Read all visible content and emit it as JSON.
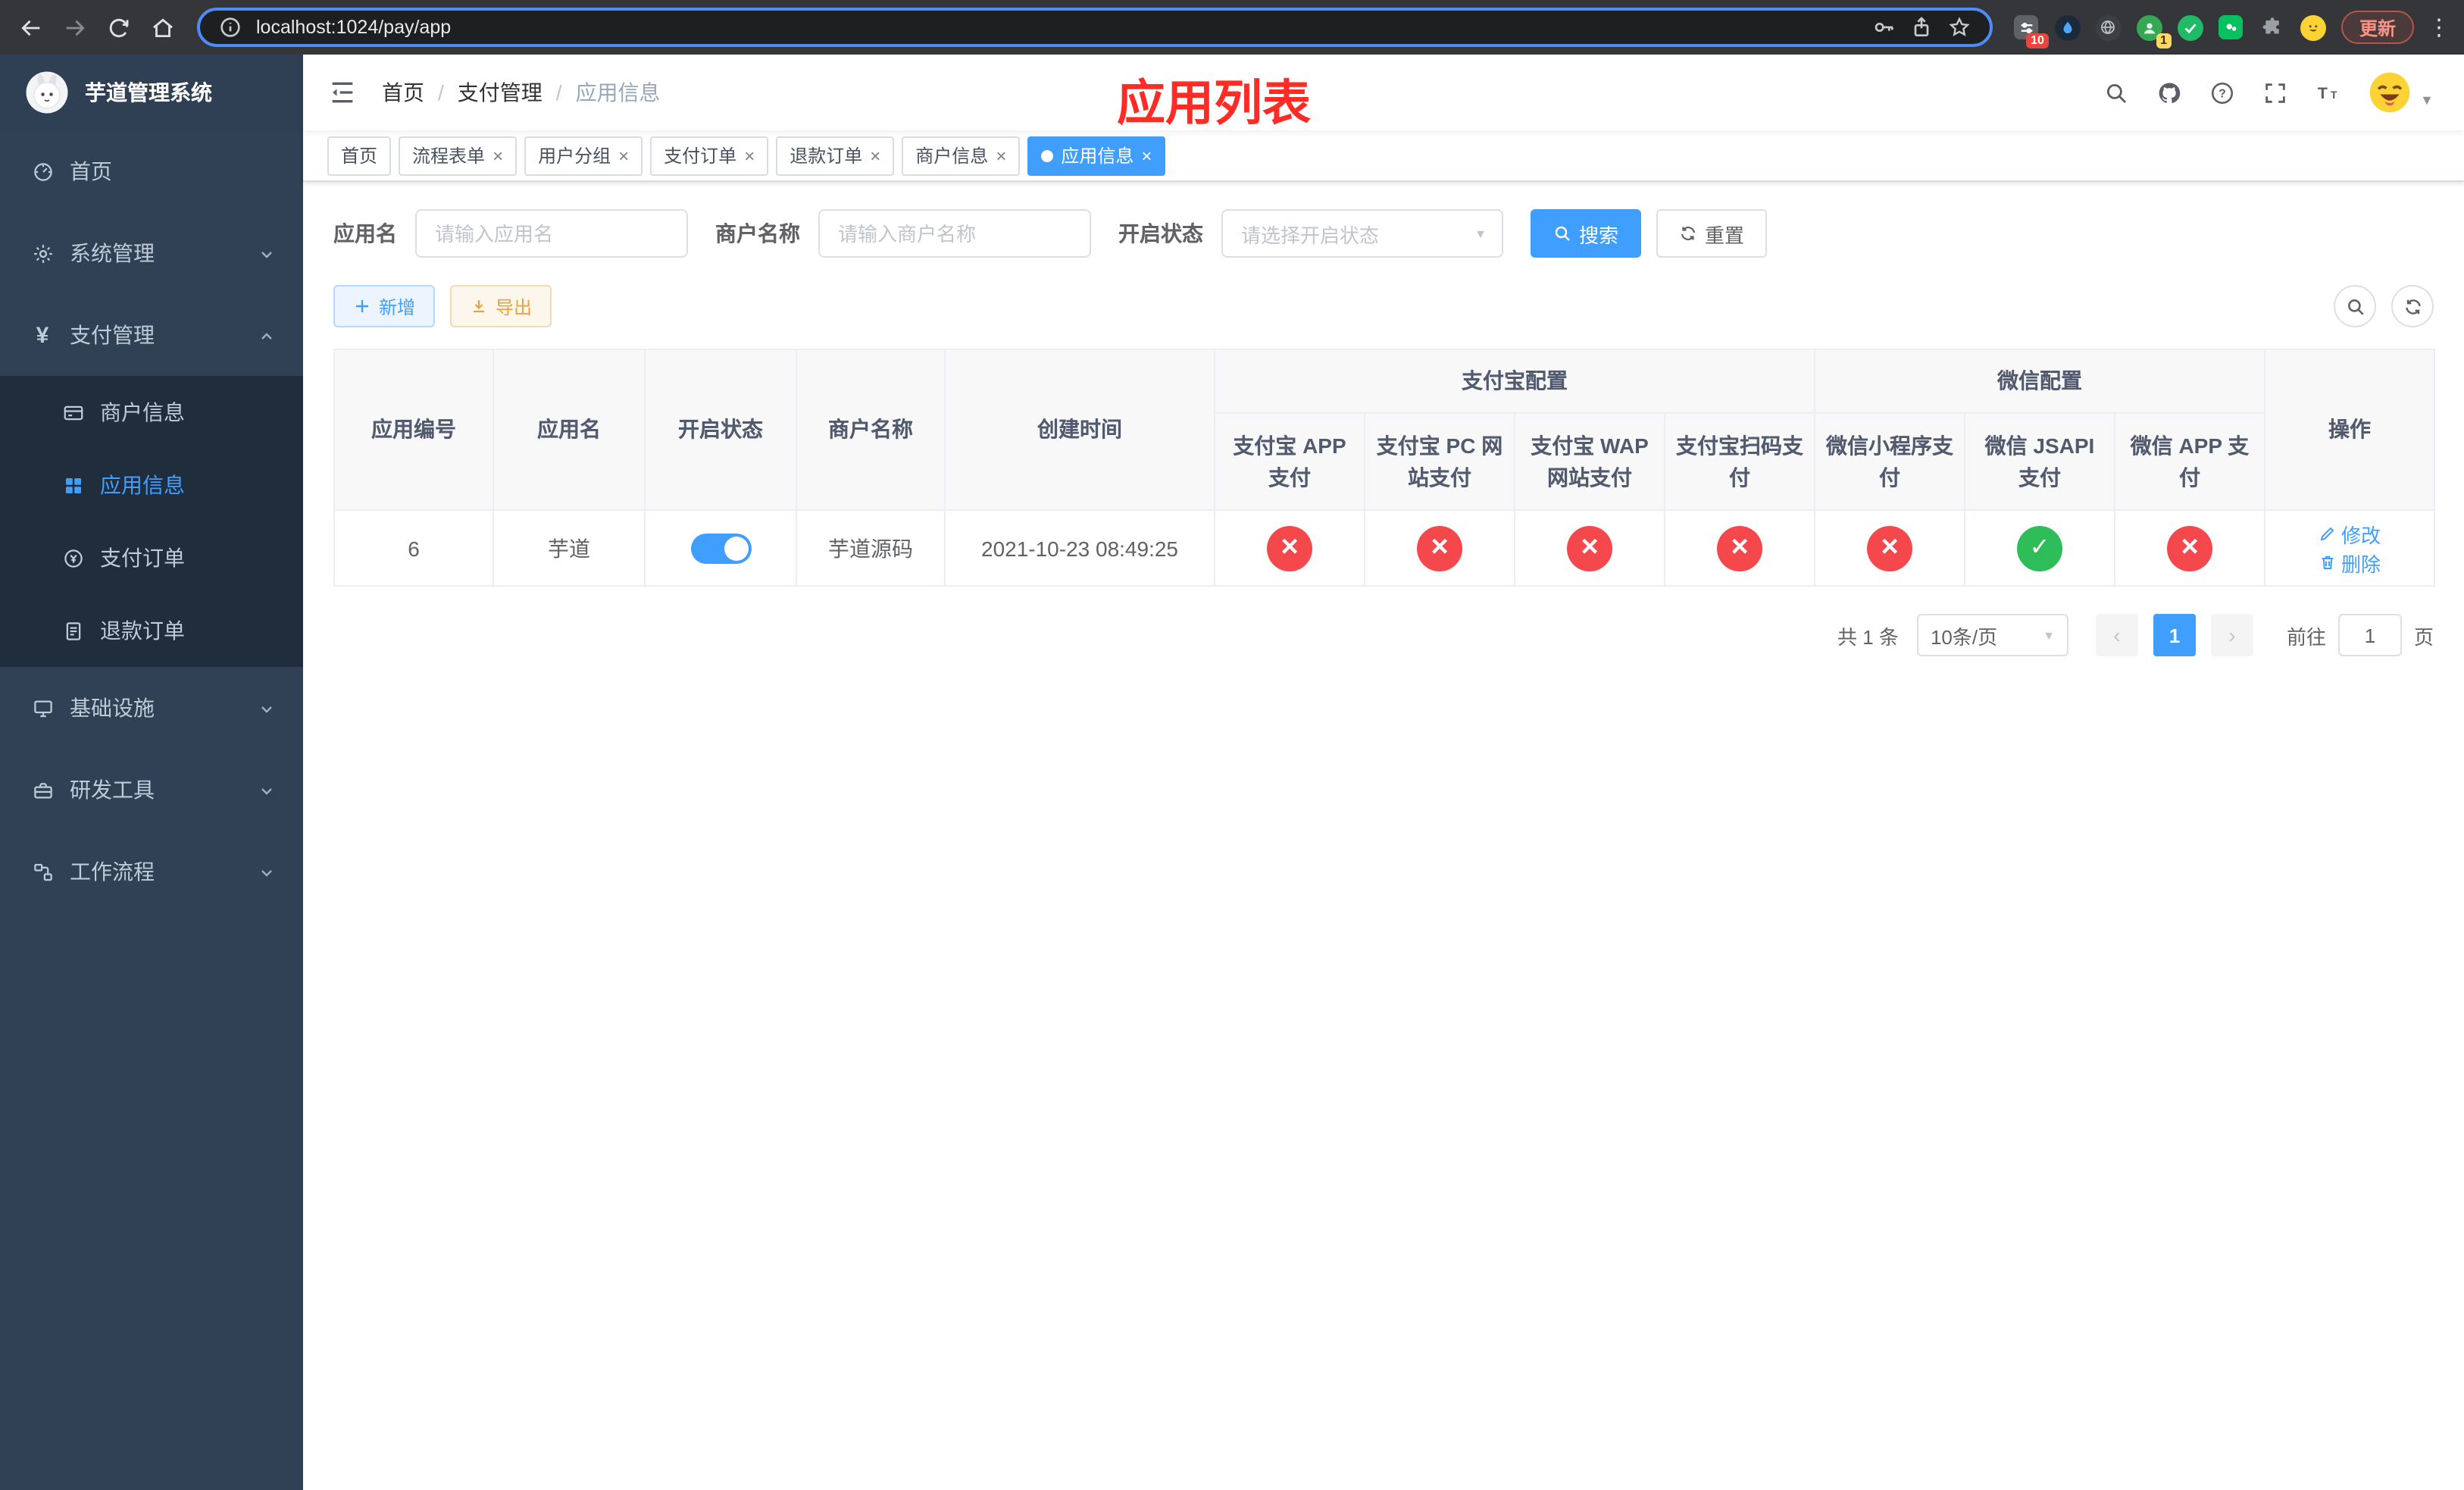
{
  "colors": {
    "accent": "#409EFF",
    "success": "#2ebd59",
    "danger": "#f5484d",
    "warning": "#e6a23c",
    "sidebar_bg": "#304156",
    "submenu_bg": "#1f2d3d",
    "overlay_title_red": "#fe2c24",
    "omnibox_focus_ring": "#4d8cf5",
    "browser_toolbar_bg": "#35363a"
  },
  "icons": {
    "close": "×",
    "check": "✓",
    "cross": "×",
    "caret_down": "▼",
    "more_vertical": "⋮",
    "prev": "‹",
    "next": "›",
    "yen": "¥"
  },
  "browser": {
    "url": "localhost:1024/pay/app",
    "update_button": "更新",
    "extensions": [
      {
        "name": "sliders-extension",
        "badge": "10"
      },
      {
        "name": "drop-extension"
      },
      {
        "name": "globe-extension"
      },
      {
        "name": "profile-extension",
        "badge": "1"
      },
      {
        "name": "check-extension"
      },
      {
        "name": "green-square-extension"
      },
      {
        "name": "puzzle-extension"
      },
      {
        "name": "emoji-extension"
      }
    ]
  },
  "sidebar": {
    "logo_title": "芋道管理系统",
    "menu": [
      {
        "label": "首页",
        "icon": "dashboard-icon"
      },
      {
        "label": "系统管理",
        "icon": "gear-icon",
        "expandable": true
      },
      {
        "label": "支付管理",
        "icon": "yen-icon",
        "expanded": true
      },
      {
        "label": "基础设施",
        "icon": "monitor-icon",
        "expandable": true
      },
      {
        "label": "研发工具",
        "icon": "tools-icon",
        "expandable": true
      },
      {
        "label": "工作流程",
        "icon": "workflow-icon",
        "expandable": true
      }
    ],
    "payment_submenu": [
      {
        "label": "商户信息",
        "icon": "card-icon"
      },
      {
        "label": "应用信息",
        "icon": "grid-icon",
        "active": true
      },
      {
        "label": "支付订单",
        "icon": "order-icon"
      },
      {
        "label": "退款订单",
        "icon": "doc-icon"
      }
    ]
  },
  "navbar": {
    "breadcrumb": [
      "首页",
      "支付管理",
      "应用信息"
    ],
    "separator": "/",
    "overlay_title": "应用列表"
  },
  "tabs": [
    {
      "label": "首页",
      "closable": false,
      "active": false
    },
    {
      "label": "流程表单",
      "closable": true,
      "active": false
    },
    {
      "label": "用户分组",
      "closable": true,
      "active": false
    },
    {
      "label": "支付订单",
      "closable": true,
      "active": false
    },
    {
      "label": "退款订单",
      "closable": true,
      "active": false
    },
    {
      "label": "商户信息",
      "closable": true,
      "active": false
    },
    {
      "label": "应用信息",
      "closable": true,
      "active": true
    }
  ],
  "filters": {
    "app_name_label": "应用名",
    "app_name_placeholder": "请输入应用名",
    "merchant_label": "商户名称",
    "merchant_placeholder": "请输入商户名称",
    "status_label": "开启状态",
    "status_placeholder": "请选择开启状态",
    "search_button": "搜索",
    "reset_button": "重置"
  },
  "toolbar": {
    "add_button": "新增",
    "export_button": "导出"
  },
  "table": {
    "columns": {
      "app_id": "应用编号",
      "app_name": "应用名",
      "status": "开启状态",
      "merchant": "商户名称",
      "create_time": "创建时间",
      "alipay_group": "支付宝配置",
      "wechat_group": "微信配置",
      "actions": "操作",
      "alipay_app": "支付宝 APP 支付",
      "alipay_pc": "支付宝 PC 网站支付",
      "alipay_wap": "支付宝 WAP 网站支付",
      "alipay_qr": "支付宝扫码支付",
      "wx_lite": "微信小程序支付",
      "wx_jsapi": "微信 JSAPI 支付",
      "wx_app": "微信 APP 支付"
    },
    "rows": [
      {
        "app_id": "6",
        "app_name": "芋道",
        "status": "on",
        "merchant": "芋道源码",
        "create_time": "2021-10-23 08:49:25",
        "alipay_app": "fail",
        "alipay_pc": "fail",
        "alipay_wap": "fail",
        "alipay_qr": "fail",
        "wx_lite": "fail",
        "wx_jsapi": "success",
        "wx_app": "fail",
        "edit_label": "修改",
        "delete_label": "删除"
      }
    ]
  },
  "pagination": {
    "total": "共 1 条",
    "page_size": "10条/页",
    "page": "1",
    "goto_label": "前往",
    "goto_value": "1",
    "goto_unit": "页"
  }
}
